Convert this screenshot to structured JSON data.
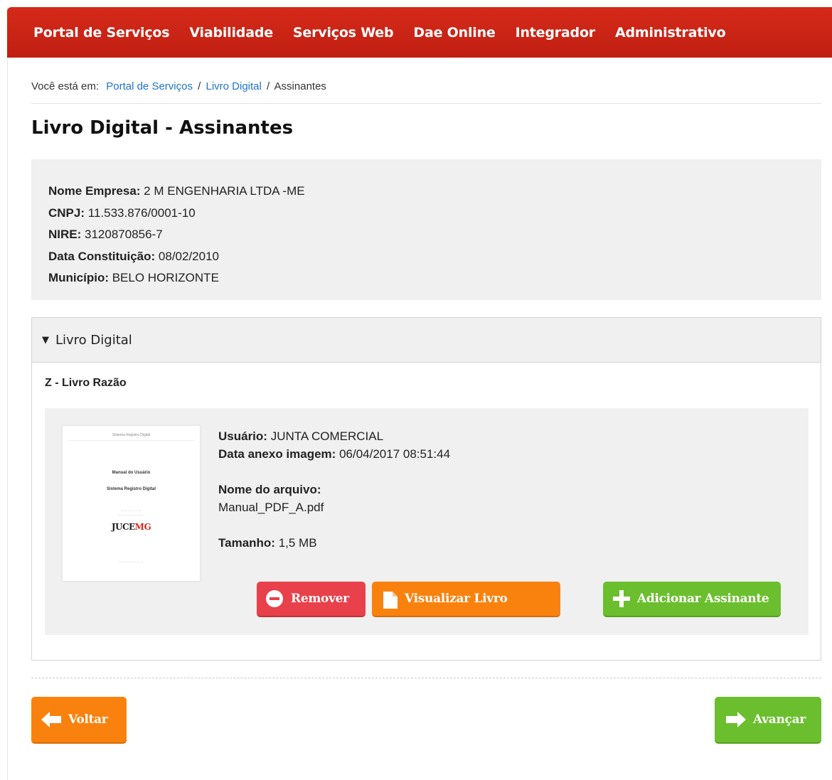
{
  "nav": {
    "items": [
      "Portal de Serviços",
      "Viabilidade",
      "Serviços Web",
      "Dae Online",
      "Integrador",
      "Administrativo"
    ]
  },
  "breadcrumb": {
    "prefix": "Você está em:",
    "links": [
      "Portal de Serviços",
      "Livro Digital"
    ],
    "separator": "/",
    "current": "Assinantes"
  },
  "page": {
    "title": "Livro Digital - Assinantes"
  },
  "company": {
    "name_label": "Nome Empresa:",
    "name": "2 M ENGENHARIA LTDA -ME",
    "cnpj_label": "CNPJ:",
    "cnpj": "11.533.876/0001-10",
    "nire_label": "NIRE:",
    "nire": "3120870856-7",
    "date_label": "Data Constituição:",
    "date": "08/02/2010",
    "city_label": "Município:",
    "city": "BELO HORIZONTE"
  },
  "panel": {
    "header": "Livro Digital",
    "book_type": "Z - Livro Razão",
    "thumbnail": {
      "head": "Sistema Registro Digital",
      "title1": "Manual do Usuário",
      "title2": "Sistema Registro Digital",
      "logo_a": "JUCE",
      "logo_b": "MG"
    },
    "user_label": "Usuário:",
    "user": "JUNTA COMERCIAL",
    "attach_label": "Data anexo imagem:",
    "attach": "06/04/2017 08:51:44",
    "file_label": "Nome do arquivo:",
    "file": "Manual_PDF_A.pdf",
    "size_label": "Tamanho:",
    "size": "1,5 MB",
    "remove_btn": "Remover",
    "view_btn": "Visualizar Livro",
    "add_btn": "Adicionar Assinante"
  },
  "footer": {
    "back_btn": "Voltar",
    "next_btn": "Avançar"
  },
  "colors": {
    "nav": "#c8231a",
    "link": "#1f74c7",
    "remove": "#e8414b",
    "view": "#f9820f",
    "add": "#6bbf2e"
  },
  "icons": [
    "minus-circle-icon",
    "document-icon",
    "plus-icon",
    "arrow-left-icon",
    "arrow-right-icon",
    "caret-down-icon"
  ]
}
